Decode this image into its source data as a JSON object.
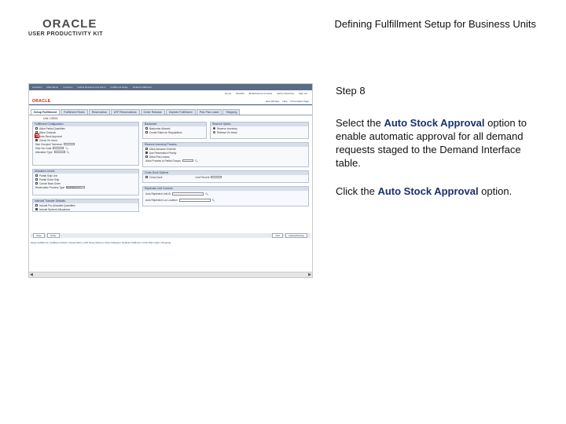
{
  "logo": {
    "brand": "ORACLE",
    "tagline": "USER PRODUCTIVITY KIT"
  },
  "header": {
    "title": "Defining Fulfillment Setup for Business Units"
  },
  "instructions": {
    "step": "Step 8",
    "para1_before": "Select the ",
    "para1_bold": "Auto Stock Approval",
    "para1_after": " option to enable automatic approval for all demand requests staged to the Demand Interface table.",
    "para2_before": "Click the ",
    "para2_bold": "Auto Stock Approval",
    "para2_after": " option."
  },
  "screenshot": {
    "topbar": [
      "Favorites",
      "Main Menu",
      "Inventory",
      "Define Business Unit Items",
      "Fulfillment Setup",
      "Default Fulfillment"
    ],
    "linkbar": [
      "Home",
      "Worklist",
      "MultiChannel Console",
      "Add to Favorites",
      "Sign out"
    ],
    "brand": "ORACLE",
    "brand_links": [
      "New Window",
      "Help",
      "Personalize Page"
    ],
    "tabs": [
      {
        "label": "Setup Fulfillment",
        "active": true
      },
      {
        "label": "Fulfillment Rules",
        "active": false
      },
      {
        "label": "Reservation",
        "active": false
      },
      {
        "label": "ATP Reservations",
        "active": false
      },
      {
        "label": "Order Release",
        "active": false
      },
      {
        "label": "Deplete Fulfillment",
        "active": false
      },
      {
        "label": "Pick Plan Label",
        "active": false
      },
      {
        "label": "Shipping",
        "active": false
      }
    ],
    "unit": "Unit: US001",
    "fulfillment_config": {
      "header": "Fulfillment Configuration",
      "rows": [
        "Allow Partial Quantities",
        "Allow Overpick",
        "Auto Stock Approval",
        "Check On Hand",
        "Max Overpick Tolerance",
        "Ship Via Code",
        "Allocation Type"
      ]
    },
    "backorder": {
      "header": "Backorder",
      "rows": [
        "Backorder Allowed",
        "Create Rules for Requisitions"
      ]
    },
    "reserve_option": {
      "header": "Reserve Option",
      "rows": [
        "Reserve Inventory",
        "Release On Hand"
      ]
    },
    "allocation": {
      "header": "Allocation Levels",
      "rows": [
        "Partial Ship Line",
        "Partial Order Ship",
        "Cancel Back Order",
        "Reservation Process Type"
      ],
      "select": "Soft Reserve"
    },
    "interunit": {
      "header": "Interunit Transfer Defaults",
      "rows": [
        "Include Pre-Allocated Quantities",
        "Include Spinned Allocations"
      ]
    },
    "reserve_process": {
      "header": "Reserve Inventory Process",
      "rows": [
        "Allow Advance Override",
        "Use Reservation Priority",
        "Allow Pick Leaves",
        "Allow Process to Partial Groups"
      ]
    },
    "cross_dock": {
      "header": "Cross Dock Options",
      "rows": [
        "Cross Dock",
        "Line Percent"
      ]
    },
    "replenish": {
      "header": "Replenish Unit Controls",
      "rows": [
        "Auto Replenish Unit ID",
        "Auto Replenish Loc Location"
      ]
    },
    "actions": [
      "Save",
      "Notify"
    ],
    "actions_right": [
      "Add",
      "Update/Display"
    ],
    "footer_links": "Setup Fulfillment | Fulfillment Rules | Reservation | ATP Reservations | Order Release | Deplete Fulfillment | Pick Plan Label | Shipping"
  }
}
